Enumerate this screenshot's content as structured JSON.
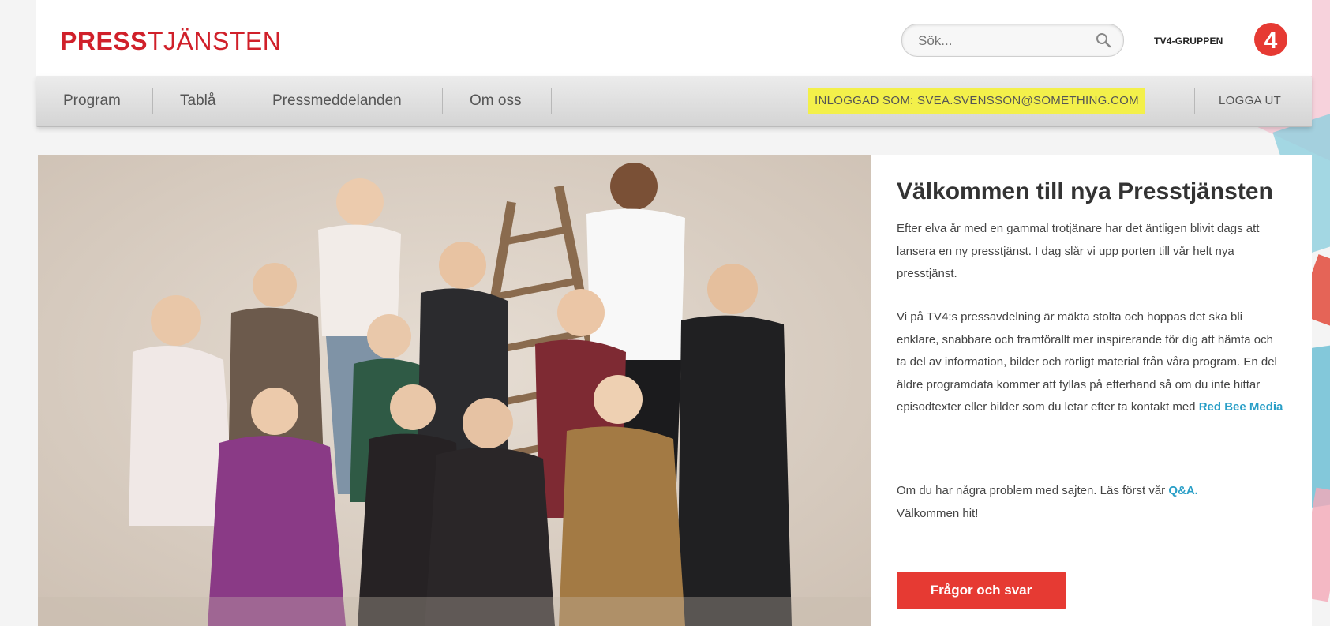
{
  "header": {
    "logo_bold": "PRESS",
    "logo_light": "TJÄNSTEN",
    "search_placeholder": "Sök...",
    "group_label": "TV4-GRUPPEN",
    "tv4_logo_digit": "4"
  },
  "nav": {
    "items": [
      {
        "label": "Program"
      },
      {
        "label": "Tablå"
      },
      {
        "label": "Pressmeddelanden"
      },
      {
        "label": "Om oss"
      }
    ],
    "logged_in_as": "INLOGGAD SOM: SVEA.SVENSSON@SOMETHING.COM",
    "logout_label": "LOGGA UT"
  },
  "welcome": {
    "title": "Välkommen till nya Presstjänsten",
    "paragraph1": "Efter elva år med en gammal trotjänare har det äntligen blivit dags att lansera en ny presstjänst. I dag slår vi upp porten till vår helt nya presstjänst.",
    "paragraph2_text": "Vi på TV4:s pressavdelning är mäkta stolta och hoppas det ska bli enklare, snabbare och framförallt mer inspirerande för dig att hämta och ta del av information, bilder och rörligt material från våra program.  En del äldre programdata kommer att fyllas på efterhand så om du inte hittar episodtexter eller bilder som du letar efter ta kontakt med ",
    "paragraph2_link": "Red Bee Media",
    "paragraph3_text": "Om du har några problem med sajten. Läs först vår ",
    "paragraph3_link": "Q&A.",
    "paragraph3_end": "Välkommen hit!",
    "cta_label": "Frågor och svar"
  },
  "colors": {
    "brand_red": "#d0202a",
    "link_blue": "#2a9fc7",
    "highlight_yellow": "#f3f04a",
    "cta_red": "#e63a33"
  }
}
